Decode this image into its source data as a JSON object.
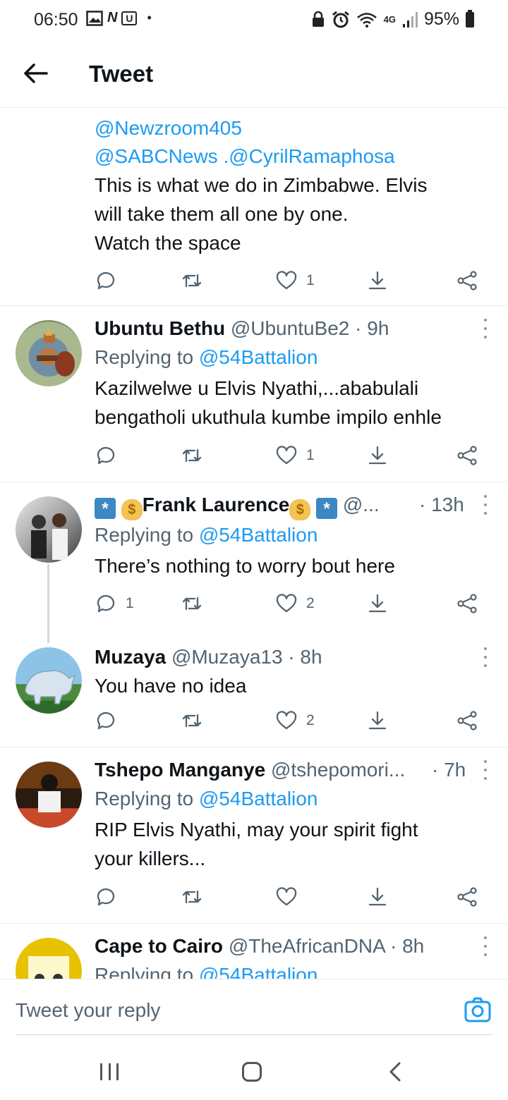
{
  "status_bar": {
    "time": "06:50",
    "left_icons": [
      "image-icon",
      "nv-icon",
      "u-icon"
    ],
    "dot": "•",
    "network": "4G",
    "battery": "95%"
  },
  "header": {
    "title": "Tweet"
  },
  "tweets": [
    {
      "mentions": [
        "@Newzroom405",
        "@SABCNews .@CyrilRamaphosa"
      ],
      "text": [
        "This is what we do in Zimbabwe. Elvis",
        "will take them all one by one.",
        "Watch the space"
      ],
      "likes": "1"
    },
    {
      "name": "Ubuntu Bethu",
      "handle": "@UbuntuBe2 · 9h",
      "replying_prefix": "Replying to ",
      "replying_to": "@54Battalion",
      "text": [
        "Kazilwelwe u Elvis Nyathi,...ababulali",
        "bengatholi ukuthula kumbe impilo enhle"
      ],
      "likes": "1"
    },
    {
      "name": "Frank Laurence",
      "handle": "@...",
      "time": "· 13h",
      "replying_prefix": "Replying to ",
      "replying_to": "@54Battalion",
      "text": [
        "There’s nothing to worry bout here"
      ],
      "replies": "1",
      "likes": "2"
    },
    {
      "name": "Muzaya",
      "handle": "@Muzaya13 · 8h",
      "text": [
        "You have no idea"
      ],
      "likes": "2"
    },
    {
      "name": "Tshepo Manganye",
      "handle": "@tshepomori...",
      "time": "· 7h",
      "replying_prefix": "Replying to ",
      "replying_to": "@54Battalion",
      "text": [
        "RIP Elvis Nyathi, may your spirit fight",
        "your killers..."
      ]
    },
    {
      "name": "Cape to Cairo",
      "handle": "@TheAfricanDNA · 8h",
      "replying_prefix": "Replying to ",
      "replying_to": "@54Battalion"
    }
  ],
  "reply_bar": {
    "placeholder": "Tweet your reply"
  },
  "colors": {
    "link": "#1d9bf0",
    "muted": "#536471",
    "text": "#0f1419",
    "divider": "#e6ecf0"
  }
}
